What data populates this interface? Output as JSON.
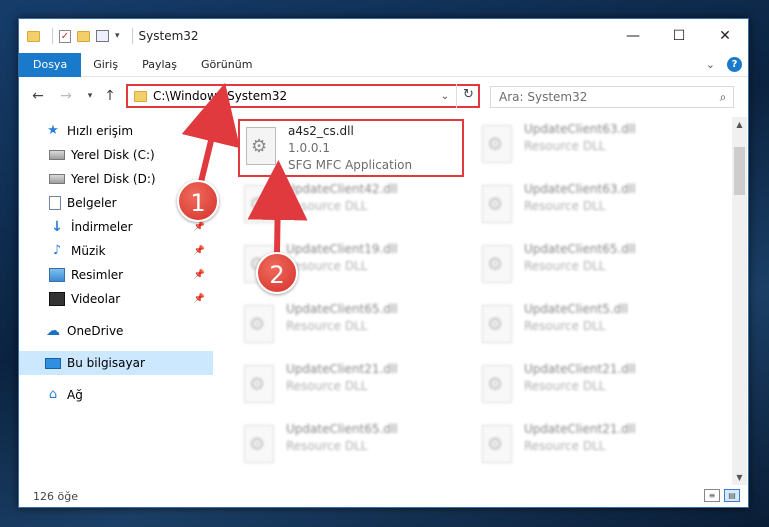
{
  "window": {
    "title": "System32",
    "controls": {
      "minimize": "—",
      "maximize": "☐",
      "close": "✕"
    }
  },
  "ribbon": {
    "tabs": [
      "Dosya",
      "Giriş",
      "Paylaş",
      "Görünüm"
    ],
    "accent_color": "#1979ca"
  },
  "address": {
    "path": "C:\\Windows\\System32",
    "search_placeholder": "Ara: System32"
  },
  "navpane": {
    "items": [
      {
        "label": "Hızlı erişim",
        "icon": "star-icon"
      },
      {
        "label": "Yerel Disk (C:)",
        "icon": "drive-icon"
      },
      {
        "label": "Yerel Disk (D:)",
        "icon": "drive-icon"
      },
      {
        "label": "Belgeler",
        "icon": "document-icon"
      },
      {
        "label": "İndirmeler",
        "icon": "download-icon"
      },
      {
        "label": "Müzik",
        "icon": "music-icon"
      },
      {
        "label": "Resimler",
        "icon": "pictures-icon"
      },
      {
        "label": "Videolar",
        "icon": "videos-icon"
      },
      {
        "label": "OneDrive",
        "icon": "cloud-icon"
      },
      {
        "label": "Bu bilgisayar",
        "icon": "computer-icon"
      },
      {
        "label": "Ağ",
        "icon": "network-icon"
      }
    ]
  },
  "files": {
    "highlighted": {
      "name": "a4s2_cs.dll",
      "version": "1.0.0.1",
      "description": "SFG MFC Application"
    },
    "left_column": [
      {
        "name": "UpdateClient42.dll",
        "description": "Resource DLL"
      },
      {
        "name": "UpdateClient19.dll",
        "description": "Resource DLL"
      },
      {
        "name": "UpdateClient65.dll",
        "description": "Resource DLL"
      },
      {
        "name": "UpdateClient21.dll",
        "description": "Resource DLL"
      },
      {
        "name": "UpdateClient65.dll",
        "description": "Resource DLL"
      }
    ],
    "right_column": [
      {
        "name": "UpdateClient63.dll",
        "description": "Resource DLL"
      },
      {
        "name": "UpdateClient63.dll",
        "description": "Resource DLL"
      },
      {
        "name": "UpdateClient65.dll",
        "description": "Resource DLL"
      },
      {
        "name": "UpdateClient5.dll",
        "description": "Resource DLL"
      },
      {
        "name": "UpdateClient21.dll",
        "description": "Resource DLL"
      },
      {
        "name": "UpdateClient21.dll",
        "description": "Resource DLL"
      }
    ]
  },
  "status": {
    "item_count": "126 öğe"
  },
  "annotations": {
    "step1": "1",
    "step2": "2",
    "color": "#e0393e"
  }
}
